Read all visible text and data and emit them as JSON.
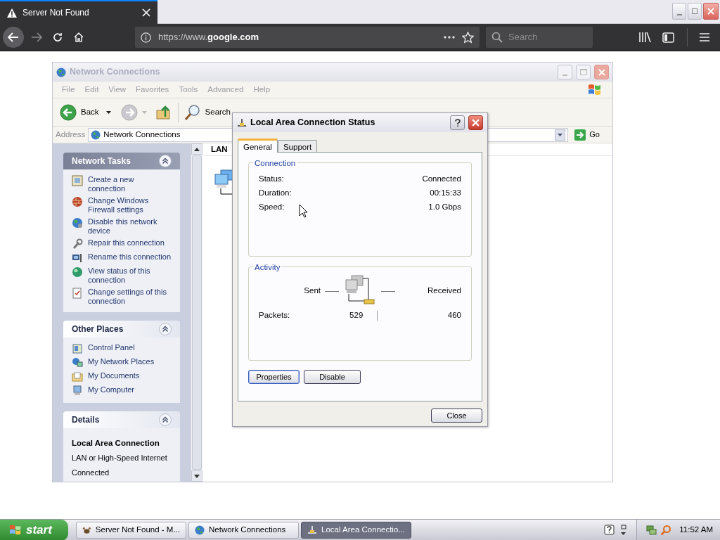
{
  "browser": {
    "tab": {
      "title": "Server Not Found"
    },
    "url": "https://www.**google.com**",
    "search": {
      "placeholder": "Search"
    }
  },
  "explorer": {
    "title": "Network Connections",
    "menu": [
      "File",
      "Edit",
      "View",
      "Favorites",
      "Tools",
      "Advanced",
      "Help"
    ],
    "toolbar": {
      "back": "Back",
      "search": "Search"
    },
    "address": {
      "label": "Address",
      "value": "Network Connections",
      "go": "Go"
    },
    "panels": [
      {
        "title": "Network Tasks",
        "special": true,
        "items": [
          "Create a new connection",
          "Change Windows Firewall settings",
          "Disable this network device",
          "Repair this connection",
          "Rename this connection",
          "View status of this connection",
          "Change settings of this connection"
        ]
      },
      {
        "title": "Other Places",
        "special": false,
        "items": [
          "Control Panel",
          "My Network Places",
          "My Documents",
          "My Computer"
        ]
      },
      {
        "title": "Details",
        "special": false,
        "details": {
          "name": "Local Area Connection",
          "lines": [
            "LAN or High-Speed Internet",
            "Connected"
          ]
        }
      }
    ],
    "column": "LAN"
  },
  "dialog": {
    "title": "Local Area Connection Status",
    "tabs": [
      {
        "label": "General",
        "selected": true
      },
      {
        "label": "Support",
        "selected": false
      }
    ],
    "connection": {
      "label": "Connection",
      "rows": [
        {
          "label": "Status:",
          "value": "Connected"
        },
        {
          "label": "Duration:",
          "value": "00:15:33"
        },
        {
          "label": "Speed:",
          "value": "1.0 Gbps"
        }
      ]
    },
    "activity": {
      "label": "Activity",
      "sent": "Sent",
      "received": "Received",
      "packets_label": "Packets:",
      "packets_sent": "529",
      "packets_received": "460"
    },
    "buttons": [
      {
        "label": "Properties",
        "default": true
      },
      {
        "label": "Disable",
        "default": false
      }
    ],
    "close": "Close"
  },
  "taskbar": {
    "start": "start",
    "tasks": [
      {
        "label": "Server Not Found - M...",
        "selected": false
      },
      {
        "label": "Network Connections",
        "selected": false
      },
      {
        "label": "Local Area Connectio...",
        "selected": true
      }
    ],
    "clock": "11:52 AM"
  }
}
